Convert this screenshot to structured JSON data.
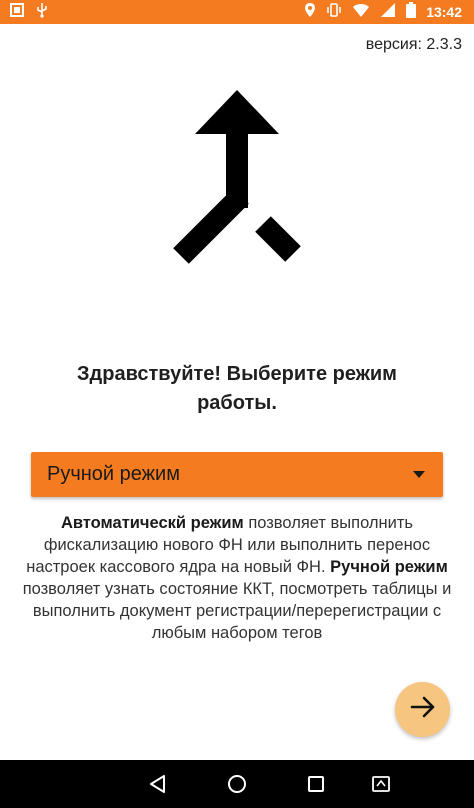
{
  "status_bar": {
    "time": "13:42",
    "left_icons": [
      "screenshot-icon",
      "usb-icon"
    ],
    "right_icons": [
      "location-icon",
      "vibrate-icon",
      "wifi-icon",
      "signal-icon",
      "battery-icon"
    ]
  },
  "version": "версия: 2.3.3",
  "logo_icon": "merge-arrow-icon",
  "greeting": "Здравствуйте! Выберите режим работы.",
  "mode_select": {
    "selected": "Ручной режим",
    "accent_color": "#f47b20"
  },
  "description": {
    "auto_title": "Автоматическй режим",
    "auto_text": "позволяет выполнить фискализацию нового ФН или выполнить перенос настроек кассового ядра на новый ФН.",
    "manual_title": "Ручной режим",
    "manual_text": "позволяет узнать состояние ККТ, посмотреть таблицы и выполнить документ регистрации/перерегистрации с любым набором тегов"
  },
  "next_button": {
    "icon": "arrow-right-icon",
    "color": "#f6c57f"
  },
  "nav_bar": {
    "buttons": [
      "back-icon",
      "home-icon",
      "recents-icon",
      "screen-rotate-icon"
    ]
  }
}
